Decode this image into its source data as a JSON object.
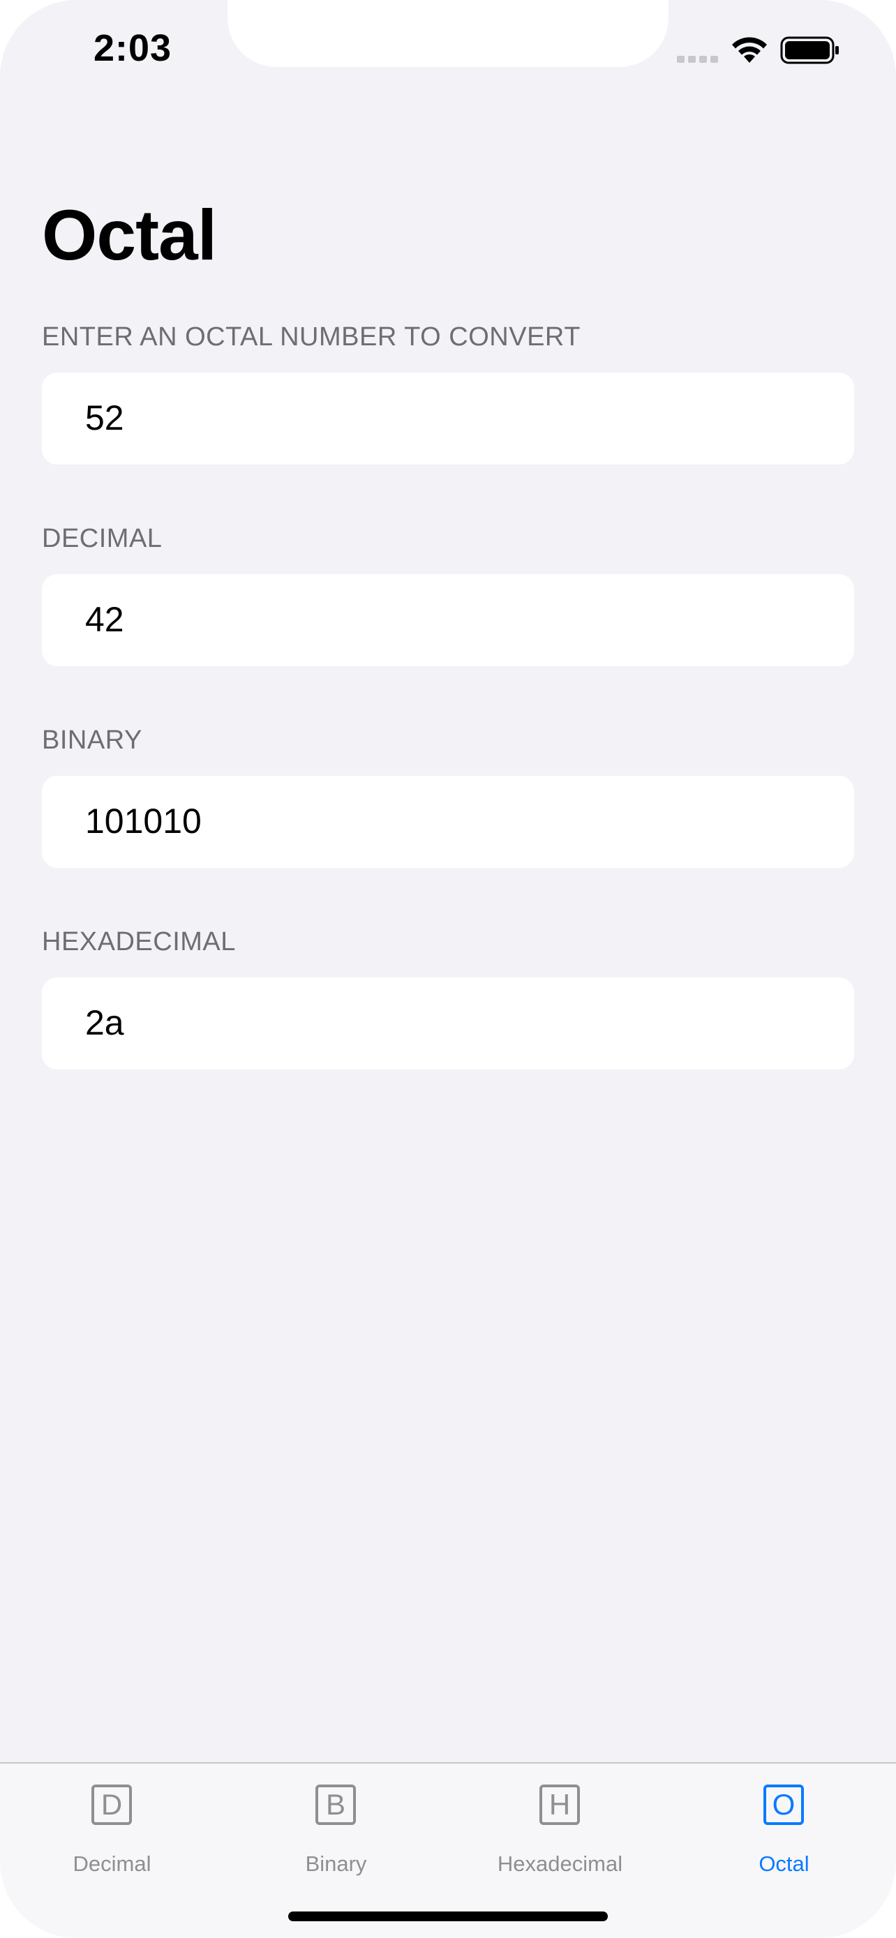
{
  "status_bar": {
    "time": "2:03"
  },
  "page": {
    "title": "Octal"
  },
  "sections": {
    "input": {
      "header": "ENTER AN OCTAL NUMBER TO CONVERT",
      "value": "52"
    },
    "decimal": {
      "header": "DECIMAL",
      "value": "42"
    },
    "binary": {
      "header": "BINARY",
      "value": "101010"
    },
    "hexadecimal": {
      "header": "HEXADECIMAL",
      "value": "2a"
    }
  },
  "tab_bar": {
    "tabs": [
      {
        "icon_letter": "D",
        "label": "Decimal",
        "active": false
      },
      {
        "icon_letter": "B",
        "label": "Binary",
        "active": false
      },
      {
        "icon_letter": "H",
        "label": "Hexadecimal",
        "active": false
      },
      {
        "icon_letter": "O",
        "label": "Octal",
        "active": true
      }
    ]
  },
  "colors": {
    "background": "#f2f2f7",
    "accent": "#0a7aff",
    "inactive": "#8e8e93",
    "section_header": "#6d6d72"
  },
  "icons": {
    "cellular": "cellular-signal-icon",
    "wifi": "wifi-icon",
    "battery": "battery-icon"
  }
}
